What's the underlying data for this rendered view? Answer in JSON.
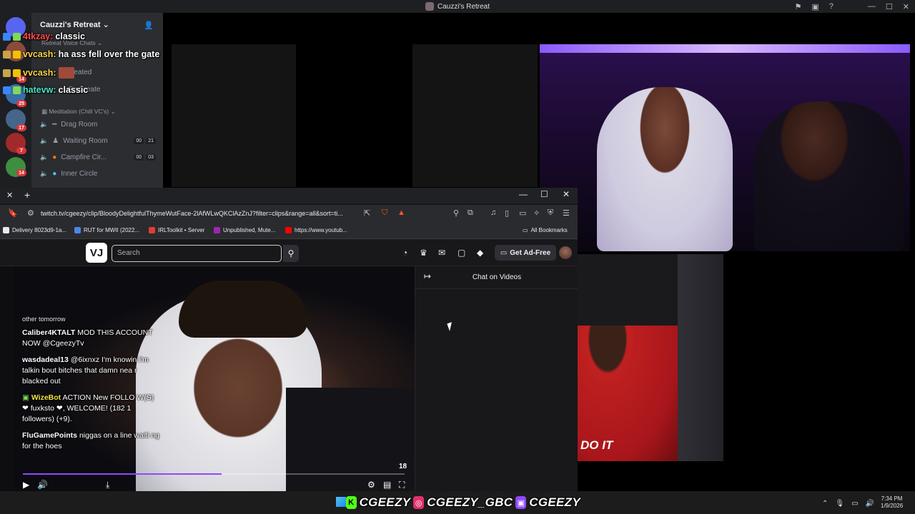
{
  "discord": {
    "window_title": "Cauzzi's Retreat",
    "server_name": "Cauzzi's Retreat",
    "categories": [
      {
        "label": "Retreat Voice Chats"
      },
      {
        "label": "Meditation (Chill VC's)"
      }
    ],
    "channels": [
      {
        "label": "reated"
      },
      {
        "label": "Fe Create"
      },
      {
        "label": "Drag Room"
      },
      {
        "label": "Waiting Room",
        "count_a": "00",
        "count_b": "21"
      },
      {
        "label": "Campfire Cir...",
        "count_a": "00",
        "count_b": "03"
      },
      {
        "label": "Inner Circle"
      }
    ],
    "server_badges": [
      "14",
      "25",
      "17",
      "7",
      "14"
    ]
  },
  "overlay_chat": [
    {
      "user": "4tkzay:",
      "message": "classic",
      "user_color": "#ff4b4b"
    },
    {
      "user": "vvcash:",
      "message": "ha ass fell over the gate",
      "user_color": "#ffd54a"
    },
    {
      "user": "vvcash:",
      "message": "",
      "user_color": "#ffd54a"
    },
    {
      "user": "hatevw:",
      "message": "classic",
      "user_color": "#4be8c8"
    }
  ],
  "browser": {
    "url": "twitch.tv/cgeezy/clip/BloodyDelightfulThymeWutFace-2lAfWLwQKClAzZnJ?filter=clips&range=all&sort=ti...",
    "bookmarks": [
      {
        "label": "Delivery 8023d9-1a...",
        "color": "#e8eaed"
      },
      {
        "label": "RUT for MWII (2022...",
        "color": "#4a86e8"
      },
      {
        "label": "IRLToolkit • Server",
        "color": "#e53935"
      },
      {
        "label": "Unpublished, Mute...",
        "color": "#9c27b0"
      },
      {
        "label": "https://www.youtub...",
        "color": "#ff0000"
      }
    ],
    "all_bookmarks": "All Bookmarks"
  },
  "twitch": {
    "logo": "VJ",
    "search_placeholder": "Search",
    "get_ad_free": "Get Ad-Free",
    "chat_title": "Chat on Videos",
    "video_time": "18",
    "progress": 0.52,
    "video_chat": [
      {
        "user": "",
        "message": "other tomorrow"
      },
      {
        "user": "Caliber4KTALT",
        "message": "MOD THIS ACCOUNT NOW @CgeezyTv",
        "user_color": "#ffffff"
      },
      {
        "user": "wasdadeal13",
        "message": "@6ixnxz I'm knowin I'm talkin bout bitches that damn nea r blacked out",
        "user_color": "#ffffff"
      },
      {
        "user": "WizeBot",
        "message": "ACTION New FOLLO W(S) ❤ fuxksto ❤, WELCOME! (182 1 followers) (+9).",
        "user_color": "#f2e33b"
      },
      {
        "user": "FluGamePoints",
        "message": "niggas on a line waiti ng for the hoes",
        "user_color": "#ffffff"
      }
    ]
  },
  "webcam_side": {
    "shirt_text": "DO IT"
  },
  "social_banner": {
    "handles": [
      "CGEEZY",
      "CGEEZY_GBC",
      "CGEEZY"
    ],
    "colors": {
      "kick": "#53fc18",
      "instagram": "#e1306c",
      "twitch": "#9147ff"
    }
  },
  "taskbar": {
    "time": "7:34 PM",
    "date": "1/9/2026"
  }
}
